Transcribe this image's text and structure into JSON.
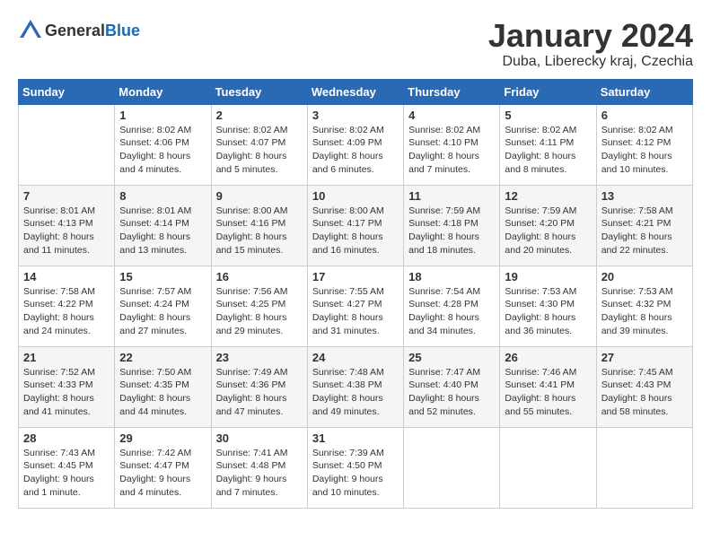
{
  "header": {
    "logo_general": "General",
    "logo_blue": "Blue",
    "month_title": "January 2024",
    "location": "Duba, Liberecky kraj, Czechia"
  },
  "days_of_week": [
    "Sunday",
    "Monday",
    "Tuesday",
    "Wednesday",
    "Thursday",
    "Friday",
    "Saturday"
  ],
  "weeks": [
    [
      {
        "day": "",
        "sunrise": "",
        "sunset": "",
        "daylight": ""
      },
      {
        "day": "1",
        "sunrise": "Sunrise: 8:02 AM",
        "sunset": "Sunset: 4:06 PM",
        "daylight": "Daylight: 8 hours and 4 minutes."
      },
      {
        "day": "2",
        "sunrise": "Sunrise: 8:02 AM",
        "sunset": "Sunset: 4:07 PM",
        "daylight": "Daylight: 8 hours and 5 minutes."
      },
      {
        "day": "3",
        "sunrise": "Sunrise: 8:02 AM",
        "sunset": "Sunset: 4:09 PM",
        "daylight": "Daylight: 8 hours and 6 minutes."
      },
      {
        "day": "4",
        "sunrise": "Sunrise: 8:02 AM",
        "sunset": "Sunset: 4:10 PM",
        "daylight": "Daylight: 8 hours and 7 minutes."
      },
      {
        "day": "5",
        "sunrise": "Sunrise: 8:02 AM",
        "sunset": "Sunset: 4:11 PM",
        "daylight": "Daylight: 8 hours and 8 minutes."
      },
      {
        "day": "6",
        "sunrise": "Sunrise: 8:02 AM",
        "sunset": "Sunset: 4:12 PM",
        "daylight": "Daylight: 8 hours and 10 minutes."
      }
    ],
    [
      {
        "day": "7",
        "sunrise": "Sunrise: 8:01 AM",
        "sunset": "Sunset: 4:13 PM",
        "daylight": "Daylight: 8 hours and 11 minutes."
      },
      {
        "day": "8",
        "sunrise": "Sunrise: 8:01 AM",
        "sunset": "Sunset: 4:14 PM",
        "daylight": "Daylight: 8 hours and 13 minutes."
      },
      {
        "day": "9",
        "sunrise": "Sunrise: 8:00 AM",
        "sunset": "Sunset: 4:16 PM",
        "daylight": "Daylight: 8 hours and 15 minutes."
      },
      {
        "day": "10",
        "sunrise": "Sunrise: 8:00 AM",
        "sunset": "Sunset: 4:17 PM",
        "daylight": "Daylight: 8 hours and 16 minutes."
      },
      {
        "day": "11",
        "sunrise": "Sunrise: 7:59 AM",
        "sunset": "Sunset: 4:18 PM",
        "daylight": "Daylight: 8 hours and 18 minutes."
      },
      {
        "day": "12",
        "sunrise": "Sunrise: 7:59 AM",
        "sunset": "Sunset: 4:20 PM",
        "daylight": "Daylight: 8 hours and 20 minutes."
      },
      {
        "day": "13",
        "sunrise": "Sunrise: 7:58 AM",
        "sunset": "Sunset: 4:21 PM",
        "daylight": "Daylight: 8 hours and 22 minutes."
      }
    ],
    [
      {
        "day": "14",
        "sunrise": "Sunrise: 7:58 AM",
        "sunset": "Sunset: 4:22 PM",
        "daylight": "Daylight: 8 hours and 24 minutes."
      },
      {
        "day": "15",
        "sunrise": "Sunrise: 7:57 AM",
        "sunset": "Sunset: 4:24 PM",
        "daylight": "Daylight: 8 hours and 27 minutes."
      },
      {
        "day": "16",
        "sunrise": "Sunrise: 7:56 AM",
        "sunset": "Sunset: 4:25 PM",
        "daylight": "Daylight: 8 hours and 29 minutes."
      },
      {
        "day": "17",
        "sunrise": "Sunrise: 7:55 AM",
        "sunset": "Sunset: 4:27 PM",
        "daylight": "Daylight: 8 hours and 31 minutes."
      },
      {
        "day": "18",
        "sunrise": "Sunrise: 7:54 AM",
        "sunset": "Sunset: 4:28 PM",
        "daylight": "Daylight: 8 hours and 34 minutes."
      },
      {
        "day": "19",
        "sunrise": "Sunrise: 7:53 AM",
        "sunset": "Sunset: 4:30 PM",
        "daylight": "Daylight: 8 hours and 36 minutes."
      },
      {
        "day": "20",
        "sunrise": "Sunrise: 7:53 AM",
        "sunset": "Sunset: 4:32 PM",
        "daylight": "Daylight: 8 hours and 39 minutes."
      }
    ],
    [
      {
        "day": "21",
        "sunrise": "Sunrise: 7:52 AM",
        "sunset": "Sunset: 4:33 PM",
        "daylight": "Daylight: 8 hours and 41 minutes."
      },
      {
        "day": "22",
        "sunrise": "Sunrise: 7:50 AM",
        "sunset": "Sunset: 4:35 PM",
        "daylight": "Daylight: 8 hours and 44 minutes."
      },
      {
        "day": "23",
        "sunrise": "Sunrise: 7:49 AM",
        "sunset": "Sunset: 4:36 PM",
        "daylight": "Daylight: 8 hours and 47 minutes."
      },
      {
        "day": "24",
        "sunrise": "Sunrise: 7:48 AM",
        "sunset": "Sunset: 4:38 PM",
        "daylight": "Daylight: 8 hours and 49 minutes."
      },
      {
        "day": "25",
        "sunrise": "Sunrise: 7:47 AM",
        "sunset": "Sunset: 4:40 PM",
        "daylight": "Daylight: 8 hours and 52 minutes."
      },
      {
        "day": "26",
        "sunrise": "Sunrise: 7:46 AM",
        "sunset": "Sunset: 4:41 PM",
        "daylight": "Daylight: 8 hours and 55 minutes."
      },
      {
        "day": "27",
        "sunrise": "Sunrise: 7:45 AM",
        "sunset": "Sunset: 4:43 PM",
        "daylight": "Daylight: 8 hours and 58 minutes."
      }
    ],
    [
      {
        "day": "28",
        "sunrise": "Sunrise: 7:43 AM",
        "sunset": "Sunset: 4:45 PM",
        "daylight": "Daylight: 9 hours and 1 minute."
      },
      {
        "day": "29",
        "sunrise": "Sunrise: 7:42 AM",
        "sunset": "Sunset: 4:47 PM",
        "daylight": "Daylight: 9 hours and 4 minutes."
      },
      {
        "day": "30",
        "sunrise": "Sunrise: 7:41 AM",
        "sunset": "Sunset: 4:48 PM",
        "daylight": "Daylight: 9 hours and 7 minutes."
      },
      {
        "day": "31",
        "sunrise": "Sunrise: 7:39 AM",
        "sunset": "Sunset: 4:50 PM",
        "daylight": "Daylight: 9 hours and 10 minutes."
      },
      {
        "day": "",
        "sunrise": "",
        "sunset": "",
        "daylight": ""
      },
      {
        "day": "",
        "sunrise": "",
        "sunset": "",
        "daylight": ""
      },
      {
        "day": "",
        "sunrise": "",
        "sunset": "",
        "daylight": ""
      }
    ]
  ]
}
